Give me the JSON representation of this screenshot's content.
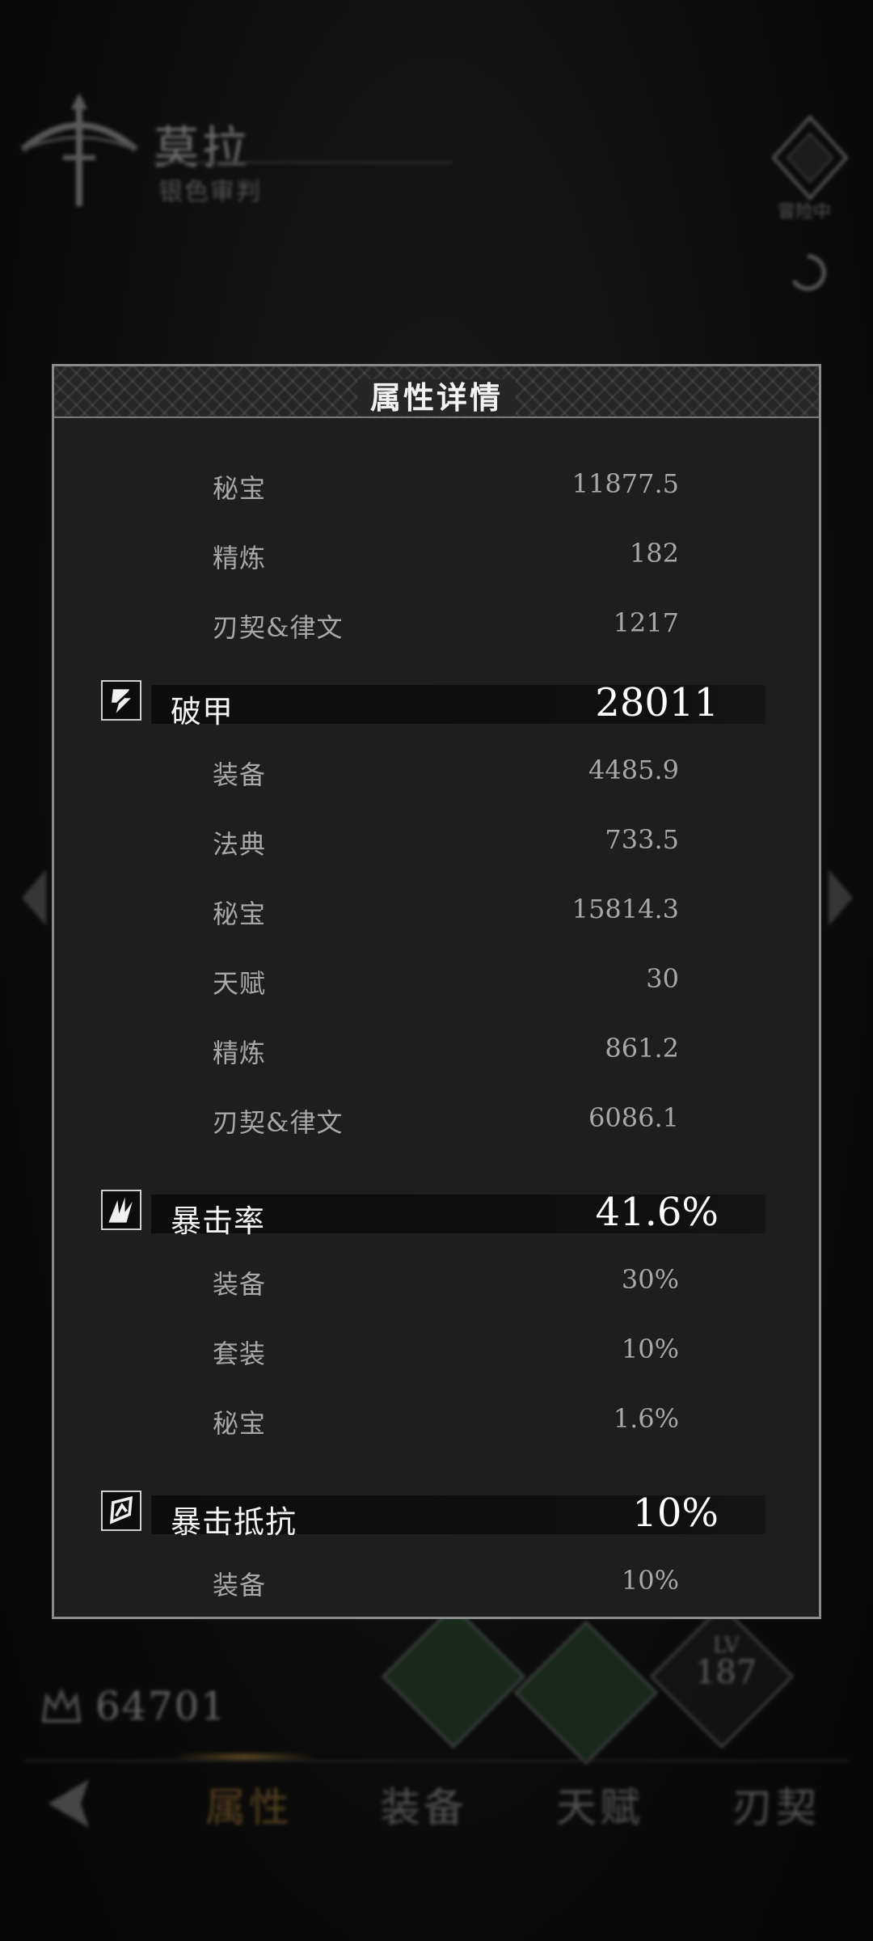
{
  "character": {
    "name": "莫拉",
    "title": "银色审判",
    "badge_text": "冒险中"
  },
  "power": {
    "value": "64701"
  },
  "skill_level": {
    "prefix": "LV",
    "value": "187"
  },
  "bottom_tabs": [
    {
      "label": "属性",
      "active": true
    },
    {
      "label": "装备",
      "active": false
    },
    {
      "label": "天赋",
      "active": false
    },
    {
      "label": "刃契",
      "active": false
    }
  ],
  "panel": {
    "title": "属性详情",
    "top_rows": [
      {
        "label": "秘宝",
        "value": "11877.5"
      },
      {
        "label": "精炼",
        "value": "182"
      },
      {
        "label": "刃契&律文",
        "value": "1217"
      }
    ],
    "sections": [
      {
        "icon": "armor-break-icon",
        "label": "破甲",
        "value": "28011",
        "rows": [
          {
            "label": "装备",
            "value": "4485.9"
          },
          {
            "label": "法典",
            "value": "733.5"
          },
          {
            "label": "秘宝",
            "value": "15814.3"
          },
          {
            "label": "天赋",
            "value": "30"
          },
          {
            "label": "精炼",
            "value": "861.2"
          },
          {
            "label": "刃契&律文",
            "value": "6086.1"
          }
        ]
      },
      {
        "icon": "crit-rate-icon",
        "label": "暴击率",
        "value": "41.6%",
        "rows": [
          {
            "label": "装备",
            "value": "30%"
          },
          {
            "label": "套装",
            "value": "10%"
          },
          {
            "label": "秘宝",
            "value": "1.6%"
          }
        ]
      },
      {
        "icon": "crit-resist-icon",
        "label": "暴击抵抗",
        "value": "10%",
        "rows": [
          {
            "label": "装备",
            "value": "10%"
          }
        ]
      }
    ]
  }
}
